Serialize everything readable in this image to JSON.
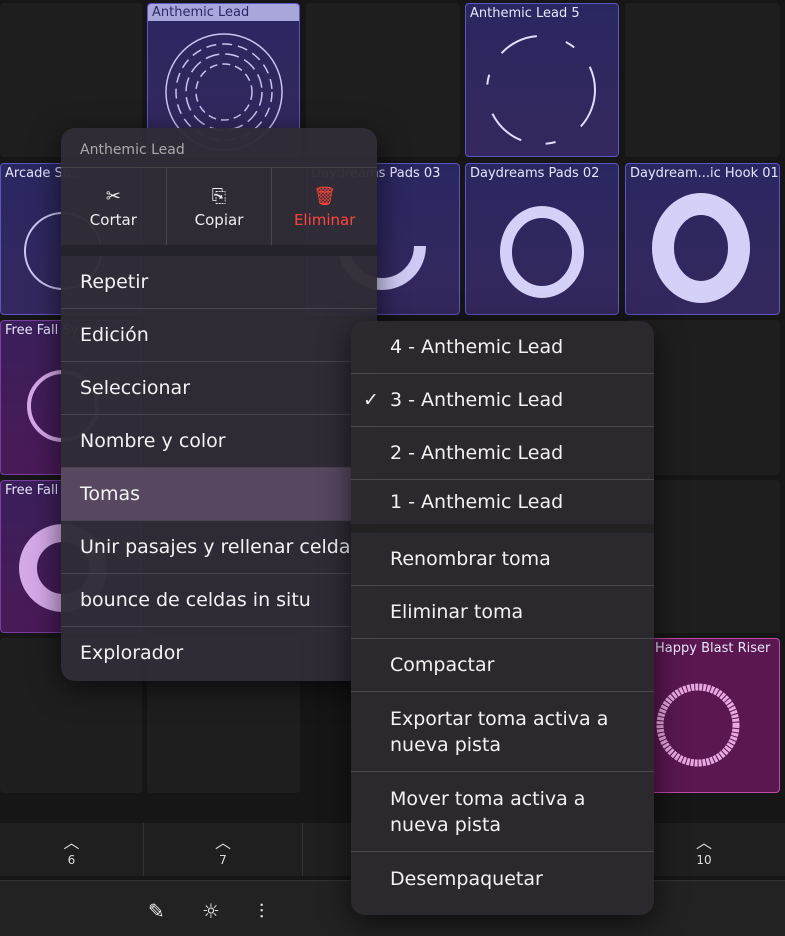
{
  "cells": [
    {
      "name": "Anthemic Lead",
      "style": "blue sel"
    },
    {
      "name": "Anthemic Lead 5",
      "style": "blue"
    },
    {
      "name": "Arcade Su...",
      "style": "blue"
    },
    {
      "name": "Daydreams Pads 03",
      "style": "blue"
    },
    {
      "name": "Daydreams Pads 02",
      "style": "blue"
    },
    {
      "name": "Daydream...ic Hook 01",
      "style": "blue"
    },
    {
      "name": "Free Fall Sy",
      "style": "purple"
    },
    {
      "name": "Free Fall A",
      "style": "purple"
    },
    {
      "name": "Happy Blast Riser",
      "style": "pink"
    }
  ],
  "tracks": [
    "6",
    "7",
    "10"
  ],
  "toolbar": {
    "icons": [
      "pencil-icon",
      "metronome-icon",
      "mixer-icon"
    ]
  },
  "menu": {
    "title": "Anthemic Lead",
    "actions": [
      {
        "label": "Cortar",
        "icon": "✂"
      },
      {
        "label": "Copiar",
        "icon": "⎘"
      },
      {
        "label": "Eliminar",
        "icon": "🗑"
      }
    ],
    "items": [
      "Repetir",
      "Edición",
      "Seleccionar",
      "Nombre y color",
      "Tomas",
      "Unir pasajes y rellenar celda",
      "bounce de celdas in situ",
      "Explorador"
    ],
    "highlighted": "Tomas"
  },
  "submenu": {
    "takes": [
      "4 - Anthemic Lead",
      "3 - Anthemic Lead",
      "2 - Anthemic Lead",
      "1 - Anthemic Lead"
    ],
    "checked": "3 - Anthemic Lead",
    "check_mark": "✓",
    "items": [
      "Renombrar toma",
      "Eliminar toma",
      "Compactar",
      "Exportar toma activa a nueva pista",
      "Mover toma activa a nueva pista",
      "Desempaquetar"
    ]
  },
  "colors": {
    "delete": "#ff453a",
    "highlight": "#574860",
    "blue_cell": "#2a2760",
    "pink_cell": "#5a1750"
  }
}
